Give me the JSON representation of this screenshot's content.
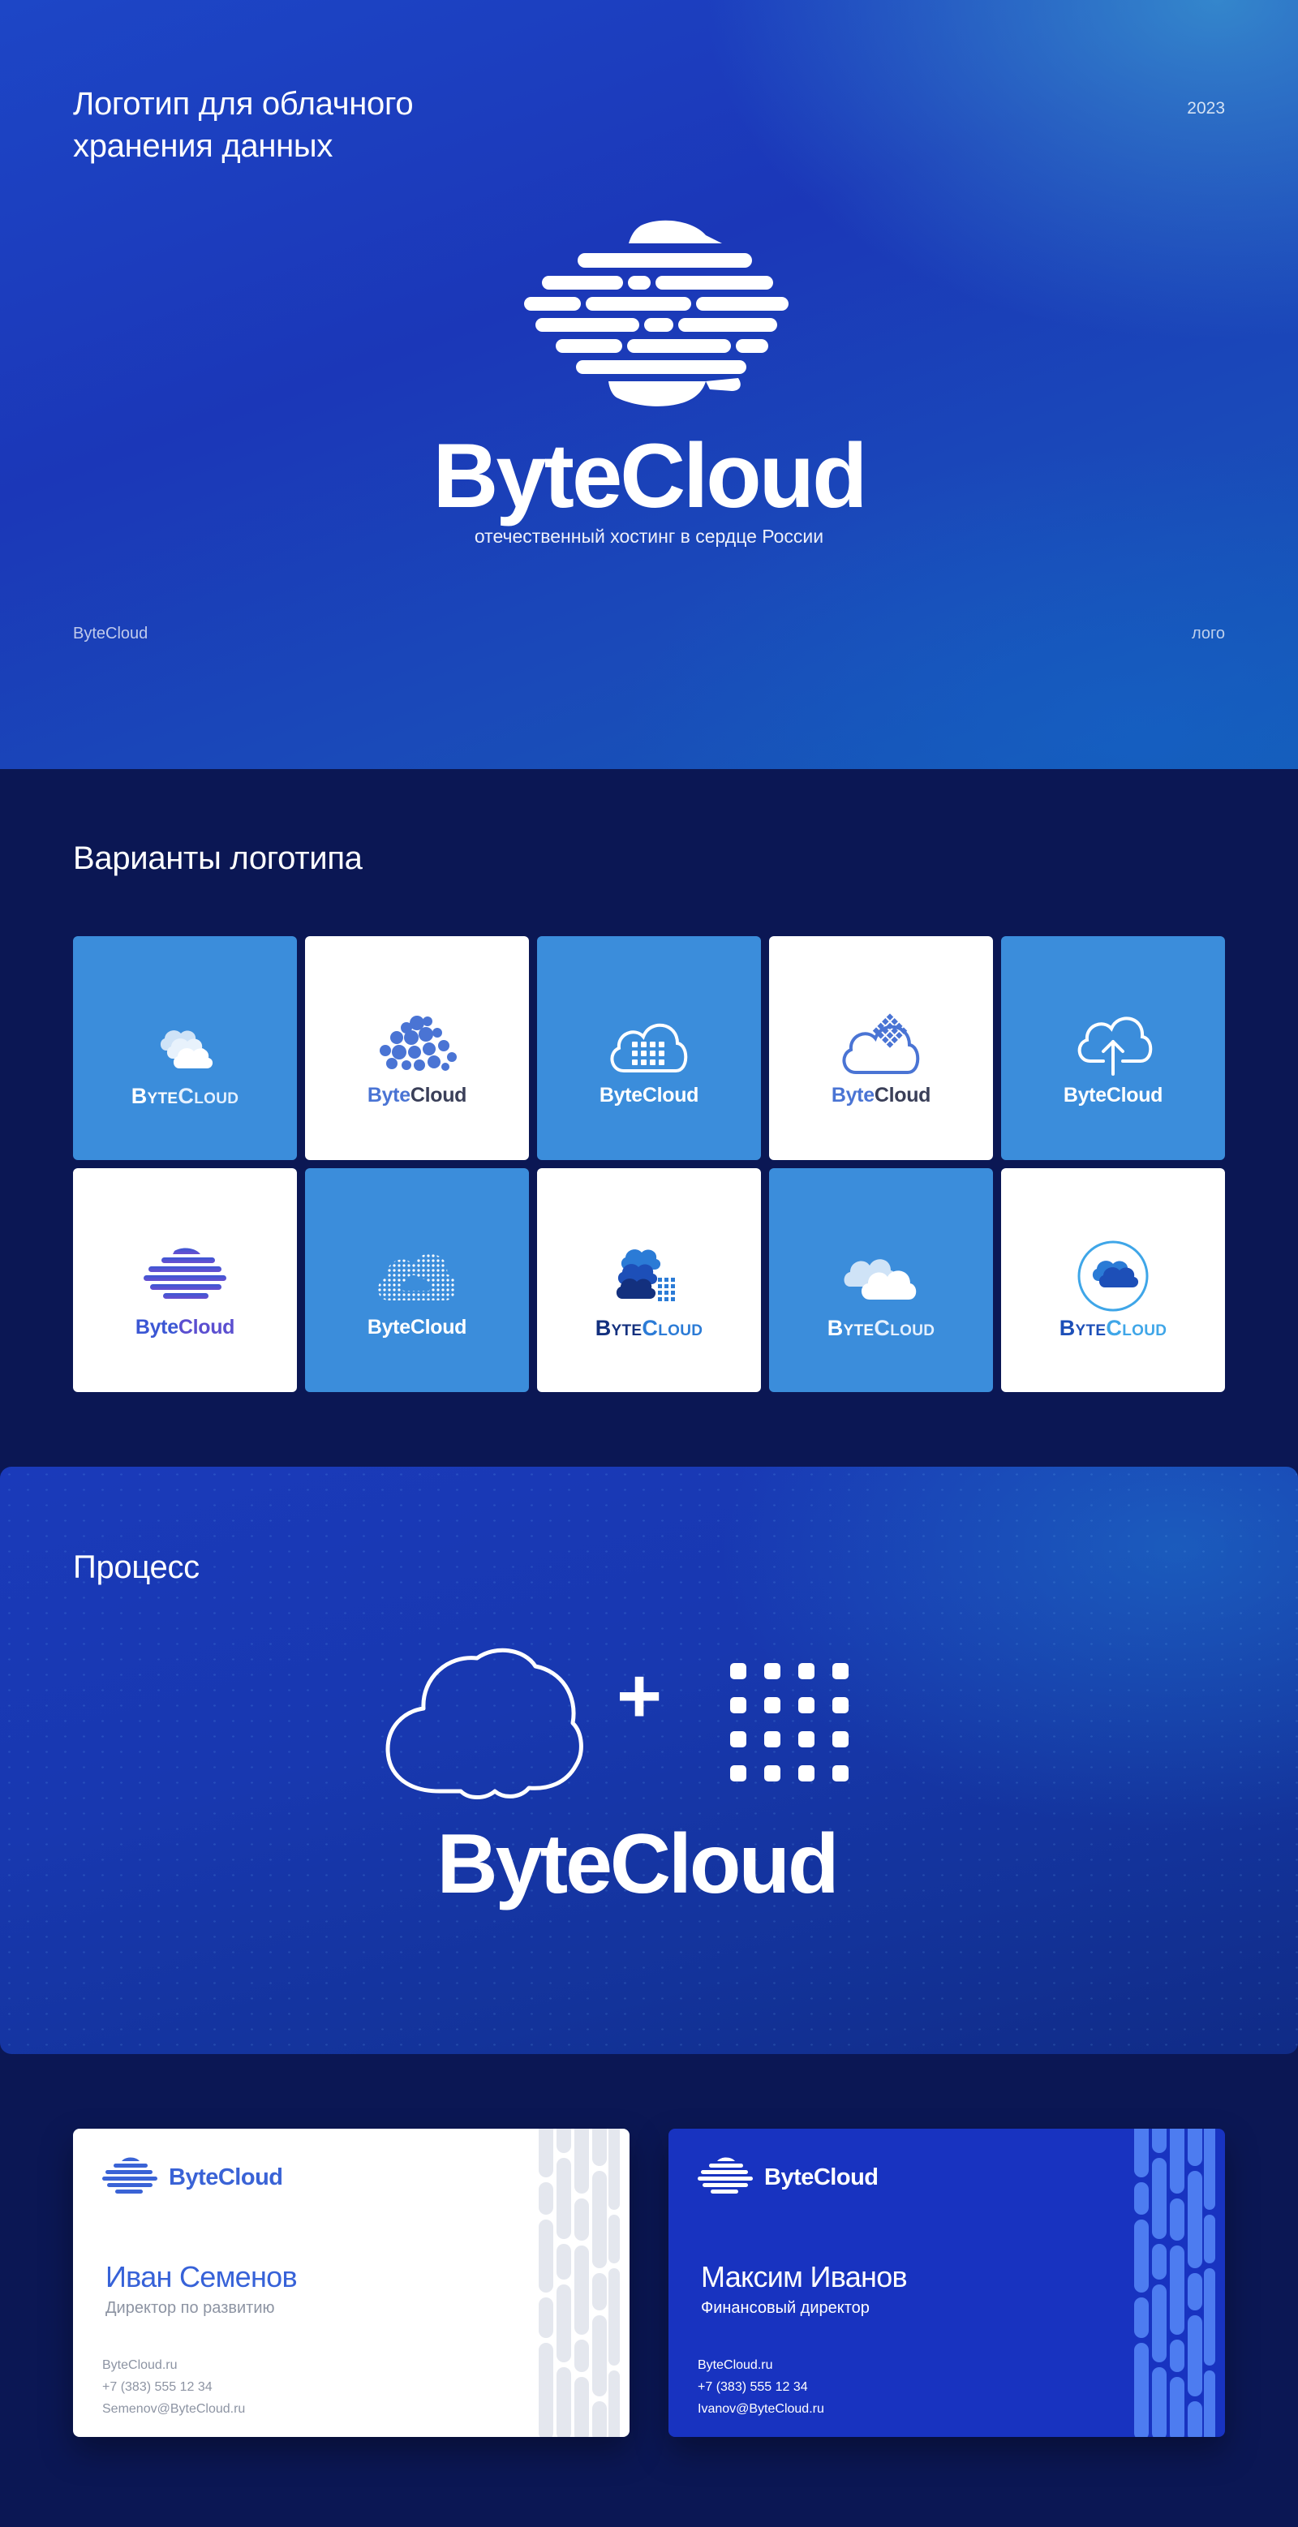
{
  "colors": {
    "accent_blue": "#3b8ddb",
    "deep_navy": "#0b1754",
    "royal_blue": "#1833c0",
    "white": "#ffffff"
  },
  "hero": {
    "title": "Логотип для облачного хранения данных",
    "year": "2023",
    "brand": "ByteCloud",
    "tagline": "отечественный хостинг в сердце России",
    "footer_left": "ByteCloud",
    "footer_right": "лого"
  },
  "variants": {
    "title": "Варианты логотипа",
    "tiles": [
      {
        "bg": "blue",
        "icon": "stacked-clouds-icon",
        "w1": "Byte",
        "w2": "Cloud"
      },
      {
        "bg": "white",
        "icon": "bubble-cloud-icon",
        "w1": "Byte",
        "w2": "Cloud"
      },
      {
        "bg": "blue",
        "icon": "grid-cloud-icon",
        "w1": "Byte",
        "w2": "Cloud"
      },
      {
        "bg": "white",
        "icon": "diamond-grid-cloud-icon",
        "w1": "Byte",
        "w2": "Cloud"
      },
      {
        "bg": "blue",
        "icon": "upload-cloud-icon",
        "w1": "Byte",
        "w2": "Cloud"
      },
      {
        "bg": "white",
        "icon": "striped-cloud-icon",
        "w1": "Byte",
        "w2": "Cloud"
      },
      {
        "bg": "blue",
        "icon": "dotted-cloud-icon",
        "w1": "Byte",
        "w2": "Cloud"
      },
      {
        "bg": "white",
        "icon": "cloud-stack-grid-icon",
        "w1": "Byte",
        "w2": "Cloud"
      },
      {
        "bg": "blue",
        "icon": "double-cloud-icon",
        "w1": "Byte",
        "w2": "Cloud"
      },
      {
        "bg": "white",
        "icon": "circle-cloud-icon",
        "w1": "Byte",
        "w2": "Cloud"
      }
    ]
  },
  "process": {
    "title": "Процесс",
    "plus": "+",
    "brand": "ByteCloud"
  },
  "cards": [
    {
      "brand": "ByteCloud",
      "name": "Иван Семенов",
      "role": "Директор по развитию",
      "site": "ByteCloud.ru",
      "phone": "+7 (383) 555 12 34",
      "email": "Semenov@ByteCloud.ru"
    },
    {
      "brand": "ByteCloud",
      "name": "Максим Иванов",
      "role": "Финансовый директор",
      "site": "ByteCloud.ru",
      "phone": "+7 (383) 555 12 34",
      "email": "Ivanov@ByteCloud.ru"
    }
  ]
}
